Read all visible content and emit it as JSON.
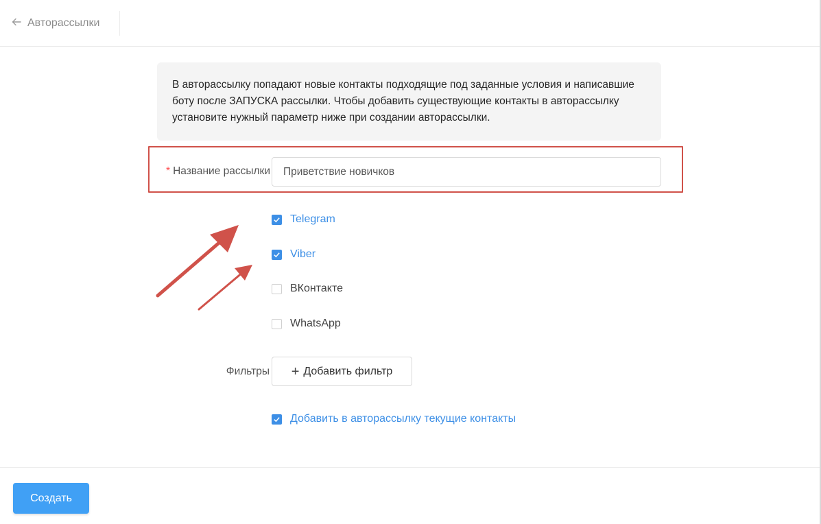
{
  "header": {
    "back_label": "Авторассылки"
  },
  "info_text": "В авторассылку попадают новые контакты подходящие под заданные условия и написавшие боту после ЗАПУСКА рассылки. Чтобы добавить существующие контакты в авторассылку установите нужный параметр ниже при создании авторассылки.",
  "form": {
    "name_label": "Название рассылки",
    "name_required_mark": "*",
    "name_value": "Приветствие новичков",
    "channels": [
      {
        "label": "Telegram",
        "checked": true
      },
      {
        "label": "Viber",
        "checked": true
      },
      {
        "label": "ВКонтакте",
        "checked": false
      },
      {
        "label": "WhatsApp",
        "checked": false
      }
    ],
    "filters_label": "Фильтры",
    "add_filter_label": "Добавить фильтр",
    "add_current_contacts_label": "Добавить в авторассылку текущие контакты",
    "add_current_contacts_checked": true
  },
  "footer": {
    "create_label": "Создать"
  },
  "colors": {
    "accent": "#3d8fe6",
    "button": "#40a0f5",
    "highlight": "#d0524a"
  }
}
